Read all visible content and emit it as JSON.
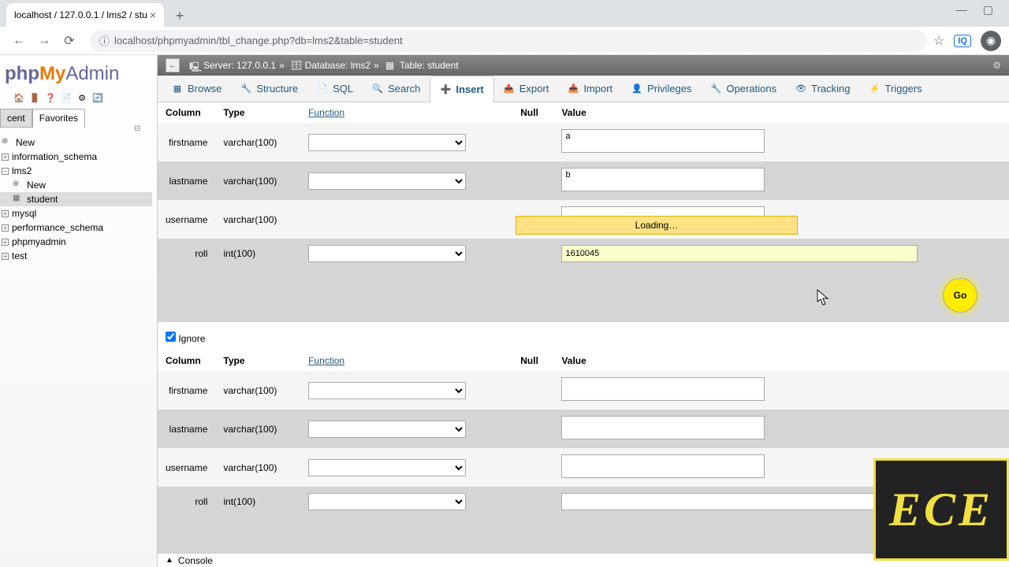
{
  "browser": {
    "tab_title": "localhost / 127.0.0.1 / lms2 / stu",
    "url": "localhost/phpmyadmin/tbl_change.php?db=lms2&table=student",
    "iq": "IQ"
  },
  "logo": {
    "php": "php",
    "my": "My",
    "admin": "Admin"
  },
  "recent": "cent",
  "favorites": "Favorites",
  "tree": {
    "new": "New",
    "information_schema": "information_schema",
    "lms2": "lms2",
    "lms2_new": "New",
    "student": "student",
    "mysql": "mysql",
    "performance_schema": "performance_schema",
    "phpmyadmin": "phpmyadmin",
    "test": "test"
  },
  "breadcrumb": {
    "server_label": "Server:",
    "server": "127.0.0.1",
    "db_label": "Database:",
    "db": "lms2",
    "table_label": "Table:",
    "table": "student"
  },
  "tabs": {
    "browse": "Browse",
    "structure": "Structure",
    "sql": "SQL",
    "search": "Search",
    "insert": "Insert",
    "export": "Export",
    "import": "Import",
    "privileges": "Privileges",
    "operations": "Operations",
    "tracking": "Tracking",
    "triggers": "Triggers"
  },
  "headers": {
    "column": "Column",
    "type": "Type",
    "function": "Function",
    "null": "Null",
    "value": "Value"
  },
  "rows": [
    {
      "name": "firstname",
      "type": "varchar(100)",
      "value": "a"
    },
    {
      "name": "lastname",
      "type": "varchar(100)",
      "value": "b"
    },
    {
      "name": "username",
      "type": "varchar(100)",
      "value": ""
    },
    {
      "name": "roll",
      "type": "int(100)",
      "value": "1610045"
    }
  ],
  "rows2": [
    {
      "name": "firstname",
      "type": "varchar(100)"
    },
    {
      "name": "lastname",
      "type": "varchar(100)"
    },
    {
      "name": "username",
      "type": "varchar(100)"
    },
    {
      "name": "roll",
      "type": "int(100)"
    }
  ],
  "go": "Go",
  "ignore": "Ignore",
  "loading": "Loading…",
  "console": "Console",
  "watermark": "ECE"
}
